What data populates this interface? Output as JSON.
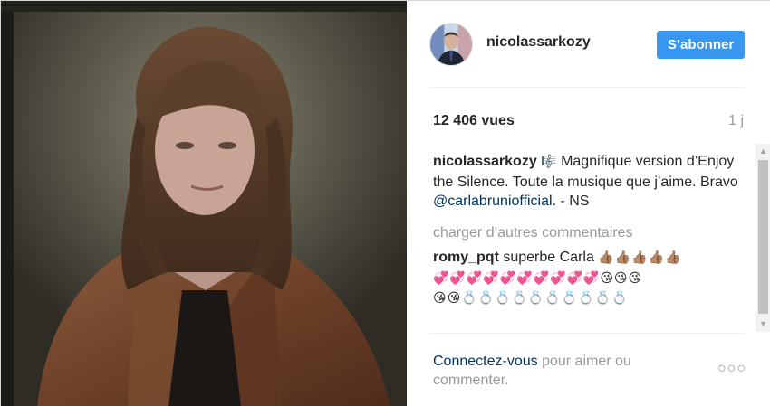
{
  "post": {
    "username": "nicolassarkozy",
    "follow_label": "S’abonner",
    "views": "12 406 vues",
    "age": "1 j"
  },
  "caption": {
    "author": "nicolassarkozy",
    "icon": "🎼",
    "text_before": " Magnifique version d’Enjoy the Silence. Toute la musique que j’aime. Bravo ",
    "mention": "@carlabrunio​fficial",
    "text_after": ". - NS"
  },
  "load_more_label": "charger d’autres commentaires",
  "comments": [
    {
      "author": "romy_pqt",
      "text": " superbe Carla ",
      "emoji_line1": "👍🏽👍🏽👍🏽👍🏽👍🏽",
      "emoji_line2": "💞💞💞💞💞💞💞💞💞💞😘😘😘",
      "emoji_line3": "😘😘💍💍💍💍💍💍💍💍💍💍"
    }
  ],
  "footer": {
    "login_link": "Connectez-vous",
    "login_text": " pour aimer ou commenter."
  },
  "icons": {
    "more": "more-options-icon",
    "avatar": "avatar"
  },
  "colors": {
    "follow_button": "#3897f0",
    "link": "#003569",
    "muted": "#999999"
  }
}
